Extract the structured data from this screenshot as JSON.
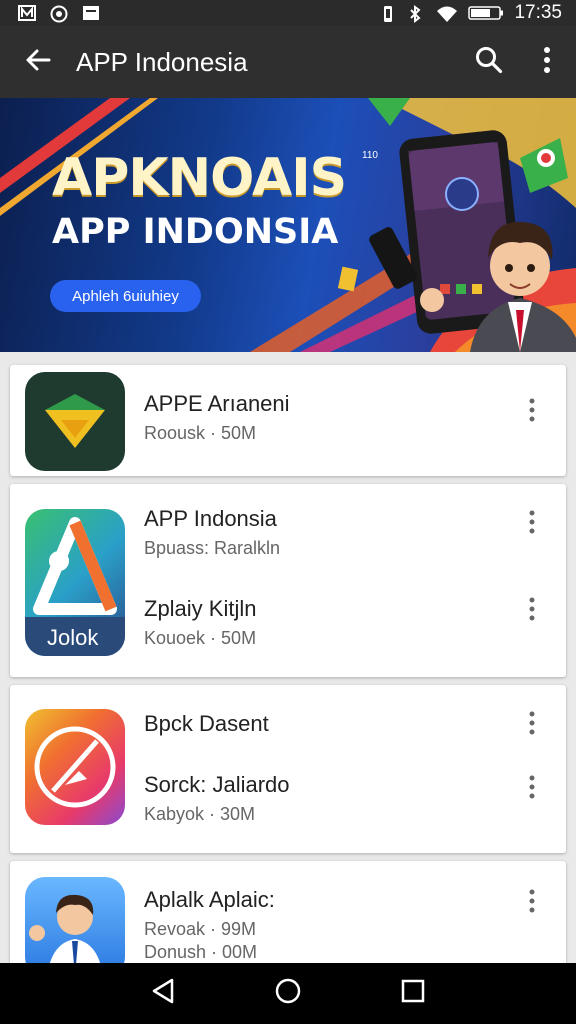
{
  "status_bar": {
    "time": "17:35",
    "left_icons": [
      "notification-m-icon",
      "notification-circle-icon",
      "notification-square-icon"
    ],
    "right_icons": [
      "vibrate-icon",
      "bluetooth-icon",
      "wifi-icon",
      "battery-icon"
    ]
  },
  "app_bar": {
    "title": "APP Indonesia",
    "icons": [
      "back-arrow-icon",
      "search-icon",
      "more-vert-icon"
    ]
  },
  "banner": {
    "title": "APKNOAIS",
    "superscript": "110",
    "subtitle": "APP INDONSIA",
    "button_label": "Aphleh 6uiuhiey"
  },
  "apps": [
    {
      "title": "APPE Arıaneni",
      "meta": "Roousk · 50M"
    },
    {
      "title": "APP Indonsia",
      "meta": "Bpuass: Raralkln"
    },
    {
      "title": "Zplaiy Kitjln",
      "meta": "Kouoek · 50M",
      "icon_label": "Jolok"
    },
    {
      "title": "Bpck Dasent"
    },
    {
      "title": "Sorck: Jaliardo",
      "meta": "Kabyok · 30M"
    },
    {
      "title": "Aplalk Aplaic:",
      "meta": "Revoak · 99M"
    },
    {
      "meta": "Donush · 00M"
    }
  ],
  "nav_bar": {
    "icons": [
      "nav-back-icon",
      "nav-home-icon",
      "nav-recents-icon"
    ]
  },
  "colors": {
    "status_bar_bg": "#2b2b2b",
    "app_bar_bg": "#2f2f2f",
    "banner_bg": "#123a8a",
    "pill_bg": "#2a62f0",
    "list_bg": "#e9e9e9",
    "nav_bar_bg": "#000000"
  }
}
